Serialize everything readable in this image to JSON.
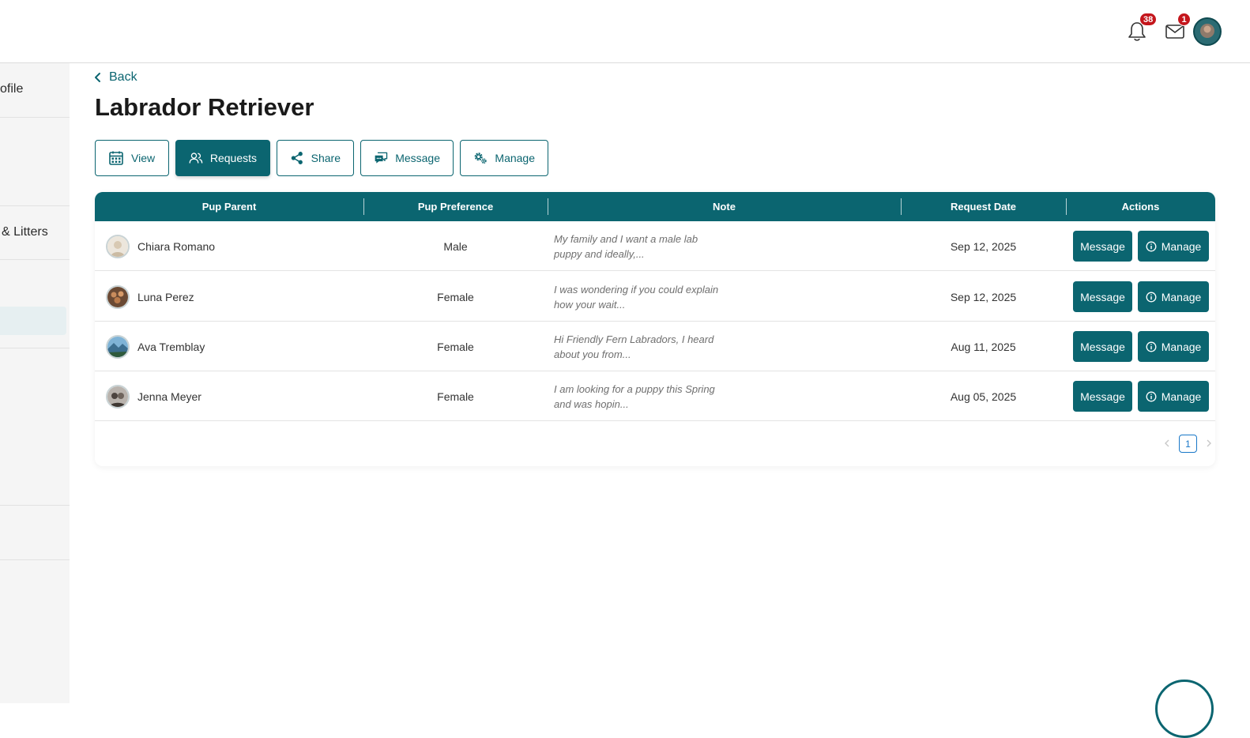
{
  "header": {
    "notifications_count": "38",
    "messages_count": "1"
  },
  "sidebar": {
    "items": [
      {
        "label": "ofile"
      },
      {
        "label": "& Litters"
      }
    ]
  },
  "page": {
    "back_label": "Back",
    "title": "Labrador Retriever"
  },
  "tabs": [
    {
      "label": "View",
      "icon": "calendar-icon"
    },
    {
      "label": "Requests",
      "icon": "users-icon",
      "active": true
    },
    {
      "label": "Share",
      "icon": "share-icon"
    },
    {
      "label": "Message",
      "icon": "chat-icon"
    },
    {
      "label": "Manage",
      "icon": "gears-icon"
    }
  ],
  "table": {
    "columns": [
      "Pup Parent",
      "Pup Preference",
      "Note",
      "Request Date",
      "Actions"
    ],
    "rows": [
      {
        "parent": "Chiara Romano",
        "preference": "Male",
        "note": "My family and I want a male lab puppy and ideally,...",
        "date": "Sep 12, 2025",
        "message_label": "Message",
        "manage_label": "Manage"
      },
      {
        "parent": "Luna Perez",
        "preference": "Female",
        "note": "I was wondering if you could explain how your wait...",
        "date": "Sep 12, 2025",
        "message_label": "Message",
        "manage_label": "Manage"
      },
      {
        "parent": "Ava Tremblay",
        "preference": "Female",
        "note": "Hi Friendly Fern Labradors, I heard about you from...",
        "date": "Aug 11, 2025",
        "message_label": "Message",
        "manage_label": "Manage"
      },
      {
        "parent": "Jenna Meyer",
        "preference": "Female",
        "note": "I am looking for a puppy this Spring and was hopin...",
        "date": "Aug 05, 2025",
        "message_label": "Message",
        "manage_label": "Manage"
      }
    ]
  },
  "pagination": {
    "current_page": "1"
  },
  "colors": {
    "brand": "#0b6570",
    "badge": "#c4161c",
    "pagination_active": "#1978c8"
  }
}
